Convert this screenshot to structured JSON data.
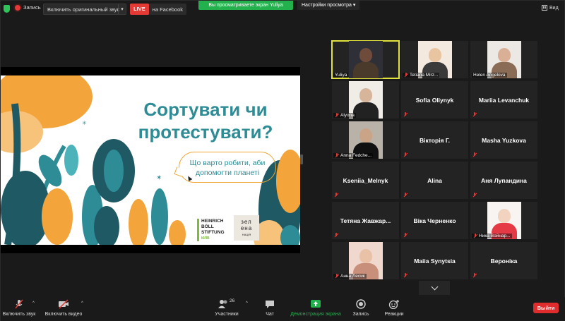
{
  "topbar": {
    "record_label": "Запись",
    "original_sound": "Включить оригинальный звук",
    "live_badge": "LIVE",
    "live_target": "на Facebook",
    "sharing_banner": "Вы просматриваете экран Yuliya",
    "view_options": "Настройки просмотра",
    "view_label": "Вид"
  },
  "slide": {
    "title_line1": "Сортувати чи",
    "title_line2": "протестувати?",
    "bubble_line1": "Що варто робити, аби",
    "bubble_line2": "допомогти планеті",
    "hbs_line1": "HEINRICH",
    "hbs_line2": "BÖLL",
    "hbs_line3": "STIFTUNG",
    "hbs_sub": "КИЇВ",
    "zelena_line1": "зел",
    "zelena_line2": "ена",
    "zelena_sub": "НАЦІЯ"
  },
  "participants": [
    {
      "name": "Yuliya",
      "video": true,
      "active": true
    },
    {
      "name": "Tetiana Mirz...",
      "video": true,
      "muted": true
    },
    {
      "name": "Helen Angelova",
      "video": true
    },
    {
      "name": "Alyona",
      "video": true,
      "muted": true
    },
    {
      "name": "Sofia Oliynyk",
      "muted": true
    },
    {
      "name": "Mariia Levanchuk",
      "muted": true
    },
    {
      "name": "Anna Fedche...",
      "video": true,
      "muted": true
    },
    {
      "name": "Вікторія Г.",
      "muted": true
    },
    {
      "name": "Masha Yuzkova",
      "muted": true
    },
    {
      "name": "Kseniia_Melnyk",
      "muted": true
    },
    {
      "name": "Alina",
      "muted": true
    },
    {
      "name": "Аня Лупандина",
      "muted": true
    },
    {
      "name": "Тетяна  Жавжар...",
      "muted": true
    },
    {
      "name": "Віка Черненко",
      "muted": true
    },
    {
      "name": "Ника Войнар...",
      "video": true,
      "muted": true
    },
    {
      "name": "Анна Лесик",
      "video": true,
      "muted": true
    },
    {
      "name": "Maiia Synytsia",
      "muted": true
    },
    {
      "name": "Вероніка",
      "muted": true
    }
  ],
  "toolbar": {
    "audio": "Включить звук",
    "video": "Включить видео",
    "participants": "Участники",
    "participants_count": "26",
    "chat": "Чат",
    "share": "Демонстрация экрана",
    "record": "Запись",
    "reactions": "Реакции",
    "leave": "Выйти"
  },
  "colors": {
    "share_green": "#23b14d",
    "live_red": "#e53935",
    "active_speaker": "#e1e33c",
    "slide_teal": "#2d8c95",
    "leave_red": "#e02c2c"
  }
}
